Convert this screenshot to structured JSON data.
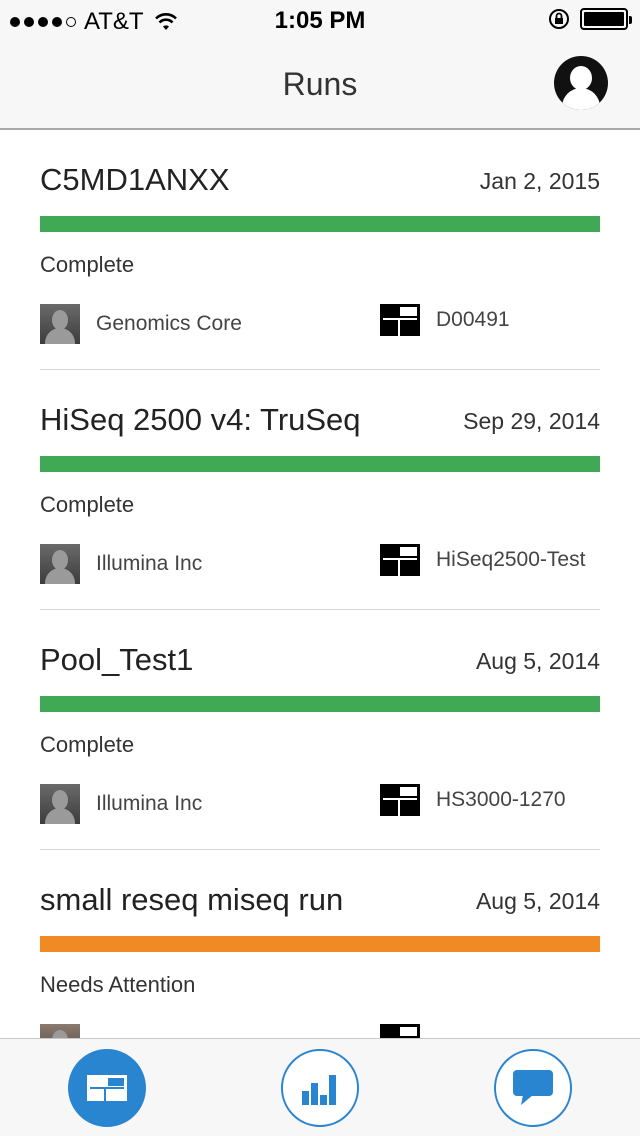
{
  "status_bar": {
    "carrier": "AT&T",
    "time": "1:05 PM",
    "signal_bars_filled": 4,
    "signal_bars_total": 5,
    "icons": [
      "wifi-icon",
      "rotation-lock-icon",
      "battery-icon"
    ]
  },
  "nav": {
    "title": "Runs",
    "profile_icon": "profile-icon"
  },
  "runs": [
    {
      "name": "C5MD1ANXX",
      "date": "Jan 2, 2015",
      "status": "Complete",
      "status_color": "#3fa955",
      "progress": 1.0,
      "owner": "Genomics Core",
      "instrument": "D00491"
    },
    {
      "name": "HiSeq 2500 v4: TruSeq",
      "date": "Sep 29, 2014",
      "status": "Complete",
      "status_color": "#3fa955",
      "progress": 1.0,
      "owner": "Illumina Inc",
      "instrument": "HiSeq2500-Test"
    },
    {
      "name": "Pool_Test1",
      "date": "Aug 5, 2014",
      "status": "Complete",
      "status_color": "#3fa955",
      "progress": 1.0,
      "owner": "Illumina Inc",
      "instrument": "HS3000-1270"
    },
    {
      "name": "small reseq miseq run",
      "date": "Aug 5, 2014",
      "status": "Needs Attention",
      "status_color": "#f28a24",
      "progress": 1.0,
      "owner": "",
      "instrument": ""
    }
  ],
  "tabs": [
    {
      "icon": "runs-icon",
      "active": true
    },
    {
      "icon": "bar-chart-icon",
      "active": false
    },
    {
      "icon": "chat-icon",
      "active": false
    }
  ],
  "colors": {
    "accent": "#2a85d0",
    "complete": "#3fa955",
    "attention": "#f28a24"
  }
}
